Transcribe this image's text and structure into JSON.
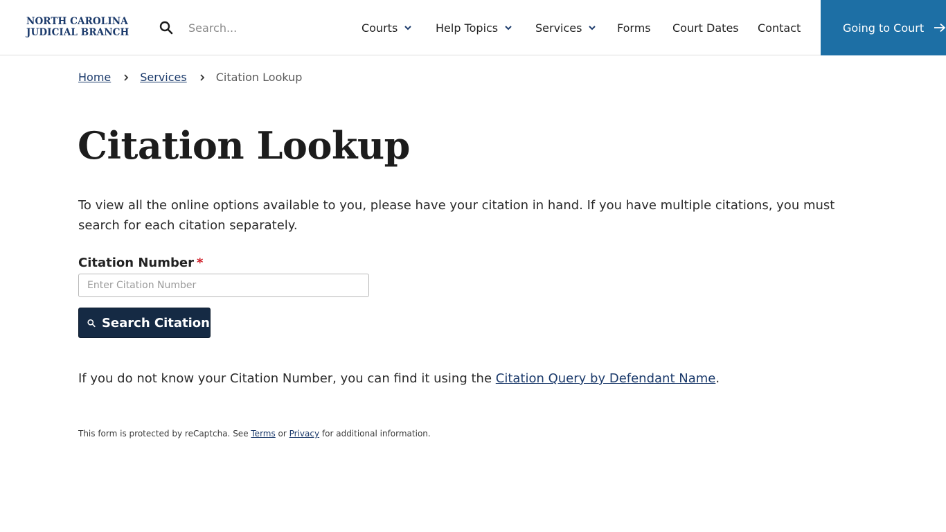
{
  "header": {
    "logo_line1": "NORTH CAROLINA",
    "logo_line2": "JUDICIAL BRANCH",
    "search_placeholder": "Search...",
    "nav": {
      "courts": "Courts",
      "help_topics": "Help Topics",
      "services": "Services",
      "forms": "Forms",
      "court_dates": "Court Dates",
      "contact": "Contact"
    },
    "cta_label": "Going to Court"
  },
  "breadcrumb": {
    "home": "Home",
    "services": "Services",
    "current": "Citation Lookup"
  },
  "main": {
    "title": "Citation Lookup",
    "intro": "To view all the online options available to you, please have your citation in hand. If you have multiple citations, you must search for each citation separately.",
    "field_label": "Citation Number",
    "required_mark": "*",
    "field_placeholder": "Enter Citation Number",
    "field_value": "",
    "search_button": "Search Citation",
    "help_prefix": "If you do not know your Citation Number, you can find it using the ",
    "help_link": "Citation Query by Defendant Name",
    "help_suffix": ".",
    "recaptcha_prefix": "This form is protected by reCaptcha. See ",
    "recaptcha_terms": "Terms",
    "recaptcha_or": " or ",
    "recaptcha_privacy": "Privacy",
    "recaptcha_suffix": " for additional information."
  },
  "colors": {
    "brand_navy": "#1b3a6b",
    "cta_blue": "#1d6fa5",
    "button_dark": "#152a44",
    "required_red": "#d0202a"
  }
}
